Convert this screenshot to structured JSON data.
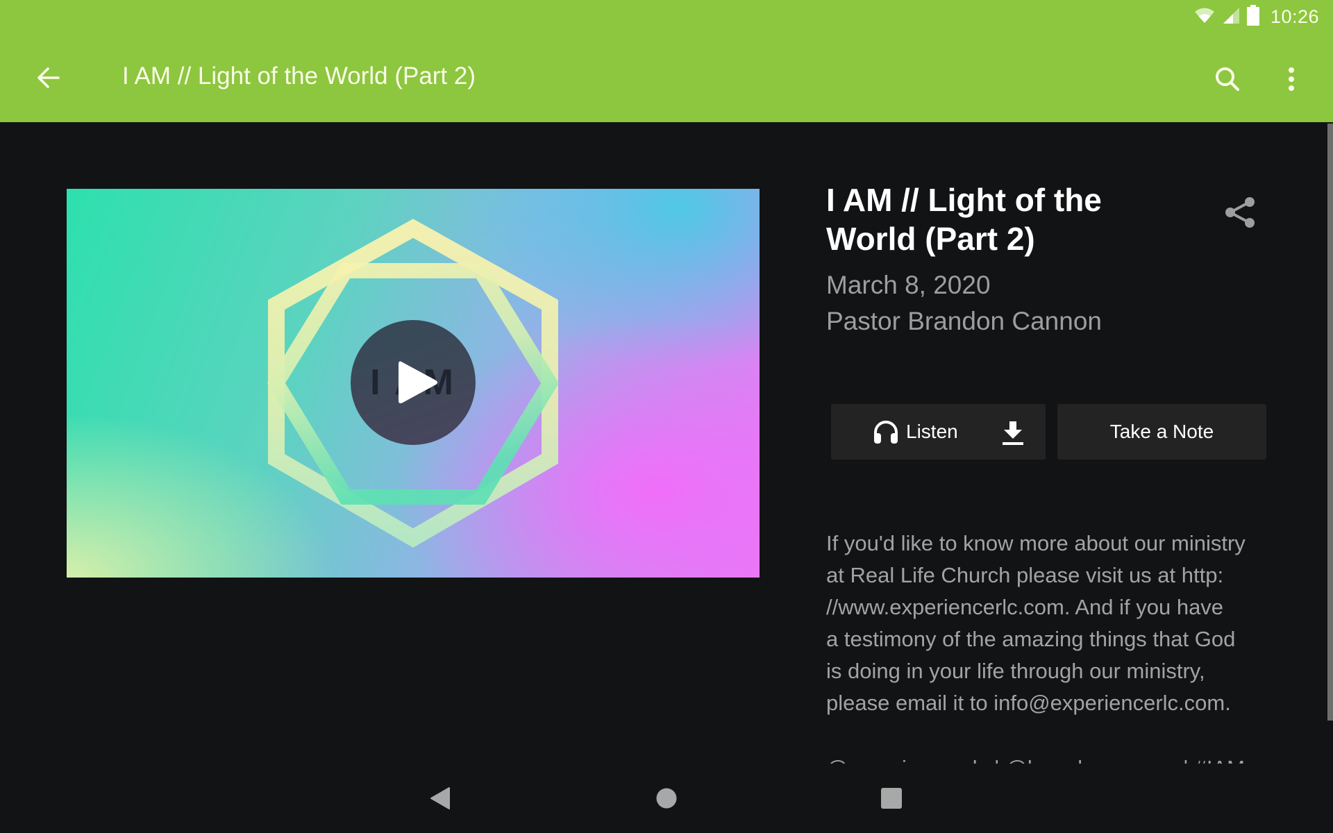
{
  "status_bar": {
    "time": "10:26",
    "icons": [
      "wifi-icon",
      "cell-signal-icon",
      "battery-icon"
    ]
  },
  "app_bar": {
    "back_icon": "arrow-left-icon",
    "title": "I AM // Light of the World (Part 2)",
    "search_icon": "search-icon",
    "more_icon": "more-vert-icon",
    "color": "#8dc63f"
  },
  "media": {
    "thumbnail_text": "I AM",
    "play_icon": "play-icon"
  },
  "sermon": {
    "title": "I AM // Light of the World (Part 2)",
    "date": "March 8, 2020",
    "speaker": "Pastor Brandon Cannon",
    "share_icon": "share-icon"
  },
  "actions": {
    "listen_label": "Listen",
    "listen_icon": "headphones-icon",
    "download_icon": "download-icon",
    "note_label": "Take a Note"
  },
  "description": {
    "text": "If you'd like to know more about our ministry at Real Life Church please visit us at http://www.experiencerlc.com. And if you have a testimony of the amazing things that God is doing in your life through our ministry, please email it to info@experiencerlc.com.",
    "lines": [
      "If you'd like to know more about our ministry",
      "at Real Life Church please visit us at http:",
      "//www.experiencerlc.com. And if you have",
      "a testimony of the amazing things that God",
      "is doing in your life through our ministry,",
      "please email it to info@experiencerlc.com."
    ],
    "cut_line": "@experience_rlc | @brandoncannon | #IAM"
  },
  "nav_bar": {
    "back": "nav-back-icon",
    "home": "nav-home-icon",
    "recents": "nav-recents-icon"
  }
}
